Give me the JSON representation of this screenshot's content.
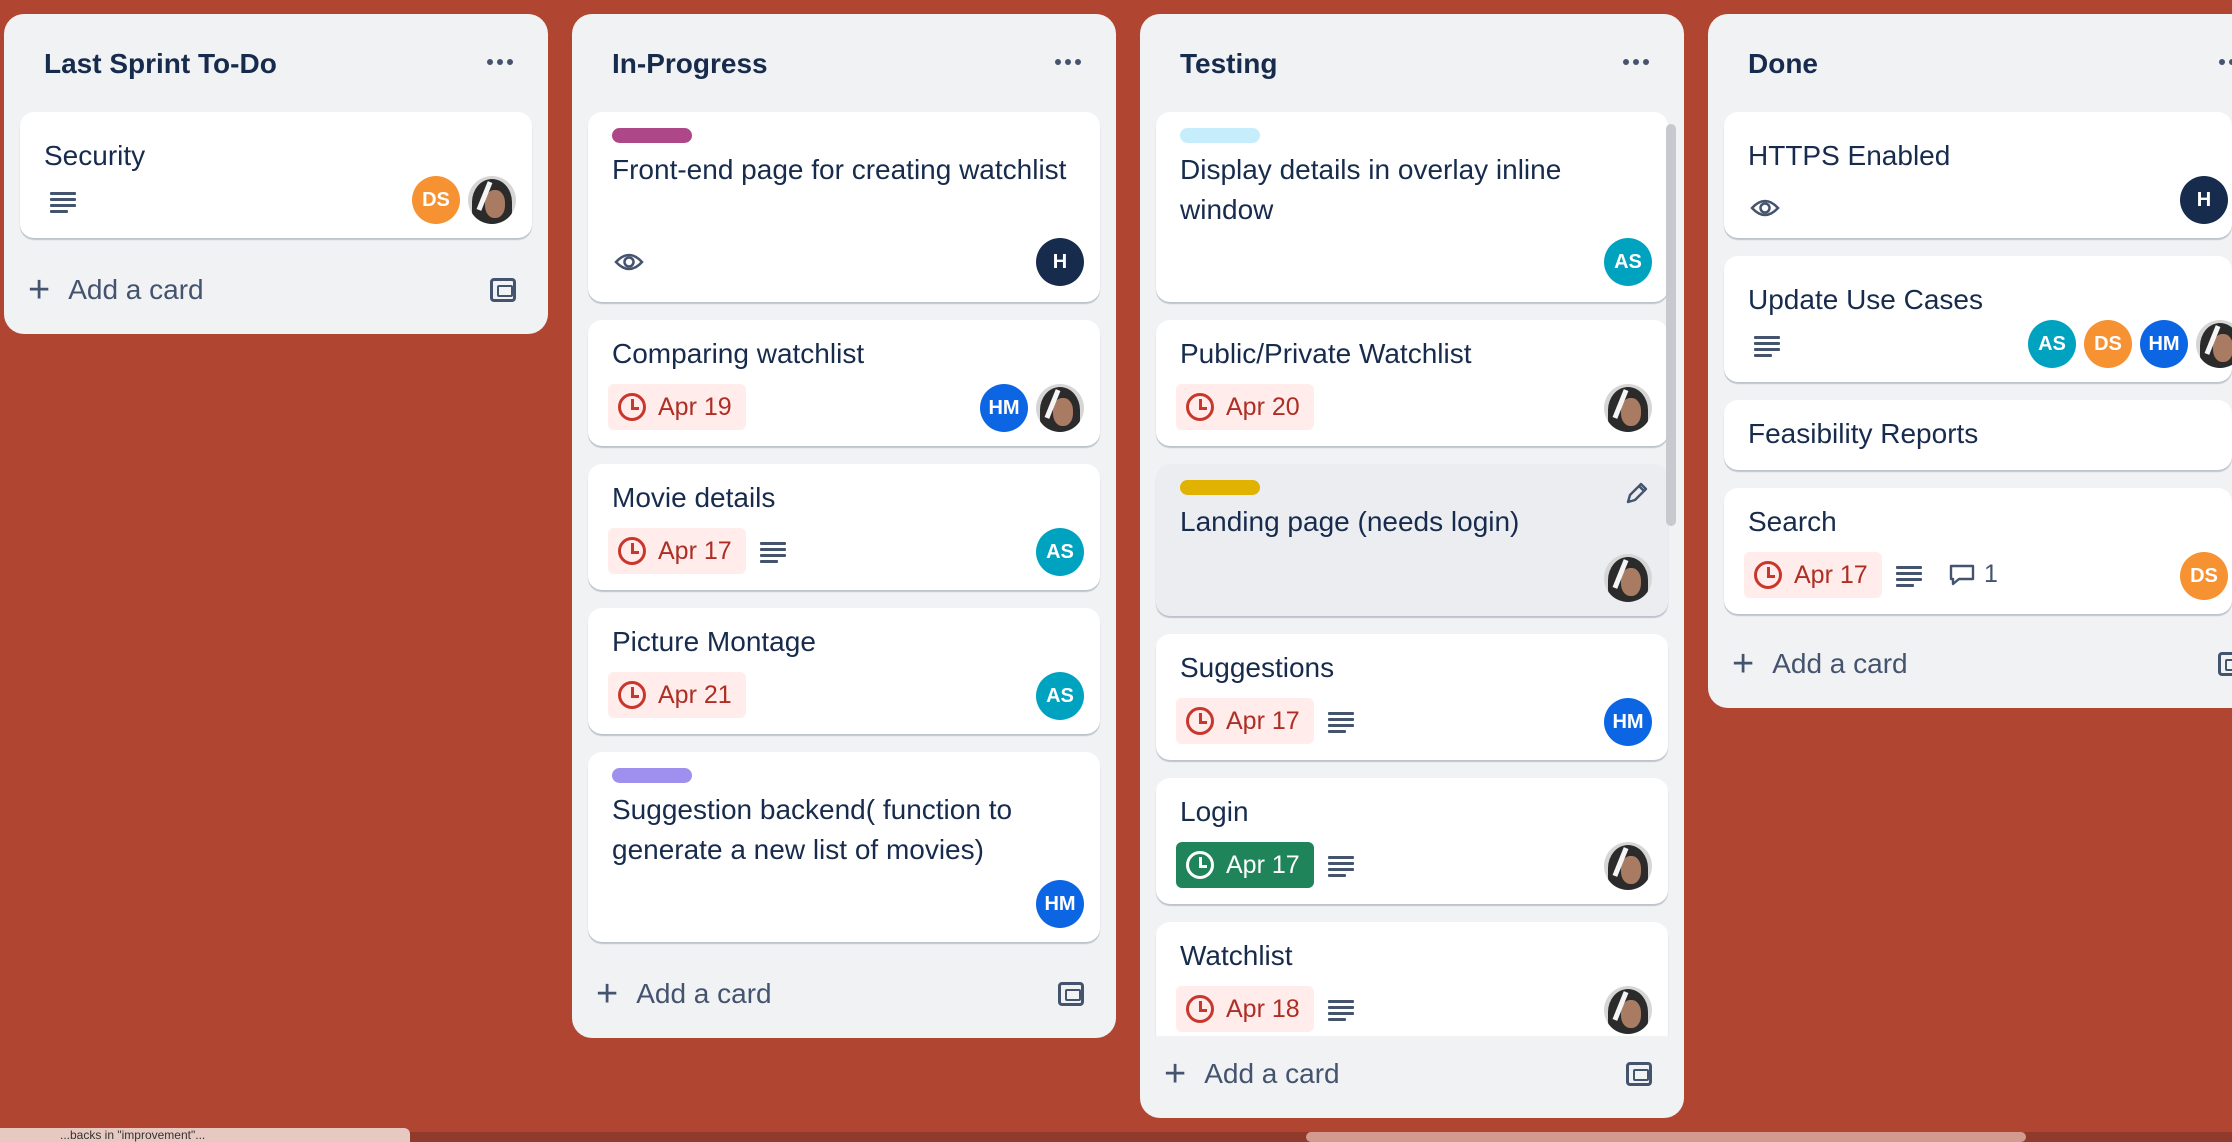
{
  "colors": {
    "board_bg": "#b04632",
    "list_bg": "#f1f2f4",
    "due_bg": "#ffeceb",
    "due_text": "#ae2e24",
    "due_complete_bg": "#1f845a",
    "label_magenta": "#ae4787",
    "label_sky": "#c6edfb",
    "label_yellow": "#e2b203",
    "label_purple": "#9f8fef",
    "avatar_DS": "#f79232",
    "avatar_AS": "#00a3bf",
    "avatar_HM": "#0c66e4",
    "avatar_H": "#172b4d"
  },
  "lists": [
    {
      "title": "Last Sprint To-Do",
      "add_card": "Add a card",
      "cards": [
        {
          "title": "Security",
          "avatars": [
            "DS",
            "photo"
          ],
          "icons": [
            "description-icon"
          ]
        }
      ]
    },
    {
      "title": "In-Progress",
      "add_card": "Add a card",
      "cards": [
        {
          "label": "magenta",
          "title": "Front-end page for creating watchlist",
          "icons": [
            "eye-icon"
          ],
          "avatars": [
            "H"
          ]
        },
        {
          "title": "Comparing watchlist",
          "due": "Apr 19",
          "avatars": [
            "HM",
            "photo"
          ]
        },
        {
          "title": "Movie details",
          "due": "Apr 17",
          "icons": [
            "description-icon"
          ],
          "avatars": [
            "AS"
          ]
        },
        {
          "title": "Picture Montage",
          "due": "Apr 21",
          "avatars": [
            "AS"
          ]
        },
        {
          "label": "purple",
          "title": "Suggestion backend( function to generate a new list of movies)",
          "avatars": [
            "HM"
          ]
        }
      ]
    },
    {
      "title": "Testing",
      "add_card": "Add a card",
      "cards": [
        {
          "label": "sky",
          "title": "Display details in overlay inline window",
          "avatars": [
            "AS"
          ]
        },
        {
          "title": "Public/Private Watchlist",
          "due": "Apr 20",
          "avatars": [
            "photo"
          ]
        },
        {
          "label": "yellow",
          "title": "Landing page (needs login)",
          "avatars": [
            "photo"
          ],
          "hovered": true
        },
        {
          "title": "Suggestions",
          "due": "Apr 17",
          "icons": [
            "description-icon"
          ],
          "avatars": [
            "HM"
          ]
        },
        {
          "title": "Login",
          "due": "Apr 17",
          "due_complete": true,
          "icons": [
            "description-icon"
          ],
          "avatars": [
            "photo"
          ]
        },
        {
          "title": "Watchlist",
          "due": "Apr 18",
          "icons": [
            "description-icon"
          ],
          "avatars": [
            "photo"
          ]
        }
      ]
    },
    {
      "title": "Done",
      "add_card": "Add a card",
      "cards": [
        {
          "title": "HTTPS Enabled",
          "icons": [
            "eye-icon"
          ],
          "avatars": [
            "H"
          ]
        },
        {
          "title": "Update Use Cases",
          "icons": [
            "description-icon"
          ],
          "avatars": [
            "AS",
            "DS",
            "HM",
            "photo"
          ]
        },
        {
          "title": "Feasibility Reports"
        },
        {
          "title": "Search",
          "due": "Apr 17",
          "icons": [
            "description-icon",
            "comment-icon"
          ],
          "comments": "1",
          "avatars": [
            "DS"
          ]
        }
      ]
    }
  ],
  "footer_tip": "...backs in \"improvement\"..."
}
